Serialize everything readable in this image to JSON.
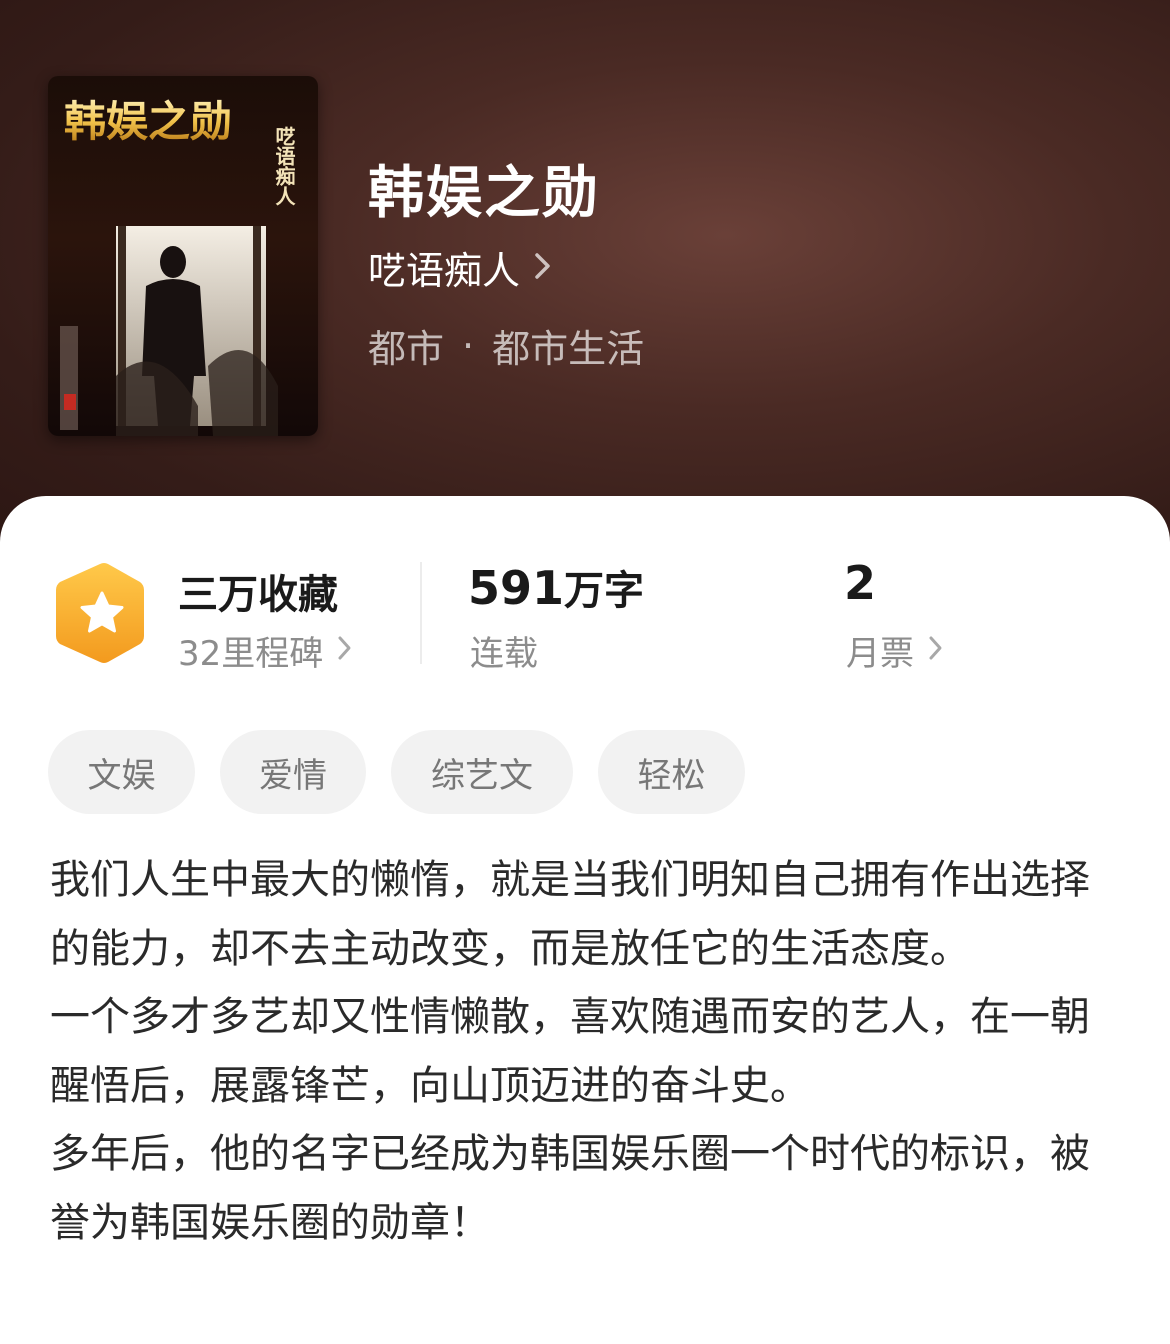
{
  "book": {
    "title": "韩娱之勋",
    "author": "呓语痴人",
    "category": "都市",
    "separator": "·",
    "subcategory": "都市生活"
  },
  "cover": {
    "title_text": "韩娱之勋",
    "author_text": "呓语痴人"
  },
  "stats": {
    "collection": {
      "label": "三万收藏",
      "sub": "32里程碑"
    },
    "words": {
      "number": "591",
      "unit": "万字",
      "status": "连载"
    },
    "monthly_ticket": {
      "number": "2",
      "label": "月票"
    }
  },
  "tags": [
    "文娱",
    "爱情",
    "综艺文",
    "轻松"
  ],
  "description": [
    "我们人生中最大的懒惰，就是当我们明知自己拥有作出选择的能力，却不去主动改变，而是放任它的生活态度。",
    "一个多才多艺却又性情懒散，喜欢随遇而安的艺人，在一朝醒悟后，展露锋芒，向山顶迈进的奋斗史。",
    "多年后，他的名字已经成为韩国娱乐圈一个时代的标识，被誉为韩国娱乐圈的勋章！"
  ],
  "colors": {
    "hero_dark": "#341c18",
    "badge_orange": "#f5a623",
    "tag_bg": "#f2f2f2"
  },
  "icons": {
    "badge": "star-hexagon-icon",
    "chevron": "chevron-right-icon"
  }
}
